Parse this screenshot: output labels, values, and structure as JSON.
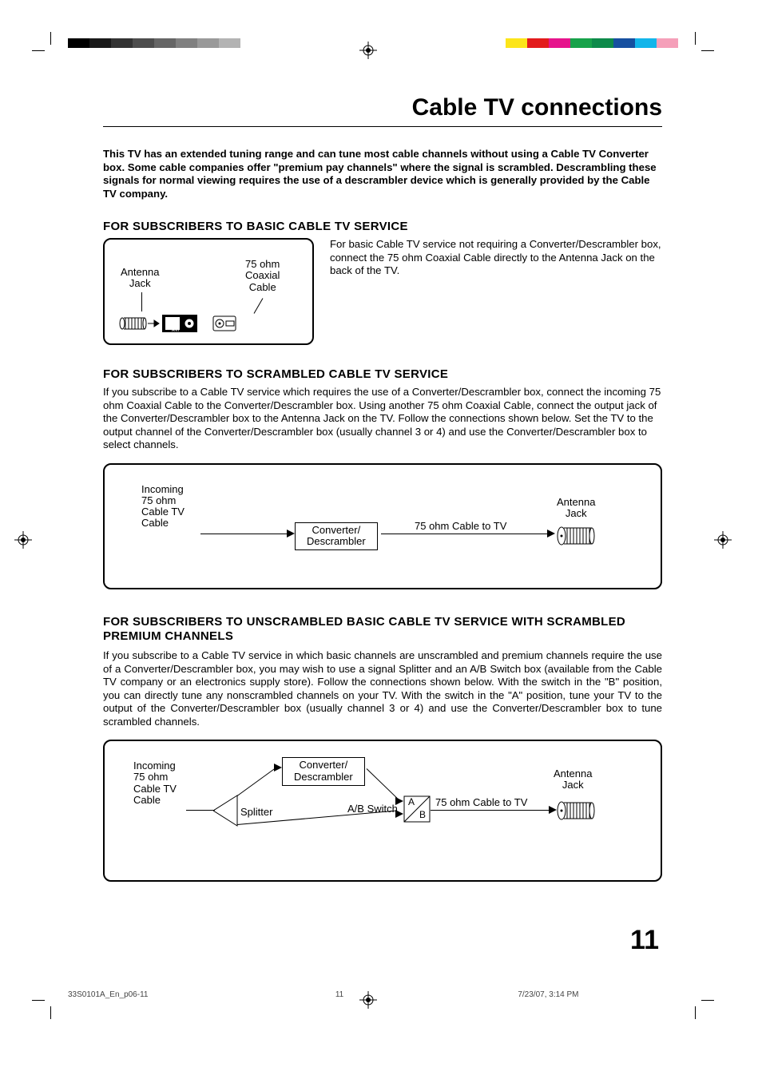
{
  "title": "Cable TV connections",
  "intro": "This TV has an extended tuning range and can tune most cable channels without using a Cable TV Converter box. Some cable companies offer \"premium pay channels\" where the signal is scrambled. Descrambling these signals for normal viewing requires the use of a descrambler device which is generally provided by the Cable TV company.",
  "section1": {
    "heading": "FOR SUBSCRIBERS TO BASIC CABLE TV SERVICE",
    "text": "For basic Cable TV service not requiring a Converter/Descrambler box, connect the 75 ohm Coaxial Cable directly to the Antenna Jack on the back of the TV.",
    "label_antenna": "Antenna\nJack",
    "label_cable": "75 ohm\nCoaxial\nCable",
    "ant_port": "ANT"
  },
  "section2": {
    "heading": "FOR SUBSCRIBERS TO SCRAMBLED CABLE TV SERVICE",
    "text": "If you subscribe to a Cable TV service which requires the use of a Converter/Descrambler box, connect the incoming 75 ohm Coaxial Cable to the Converter/Descrambler box. Using another 75 ohm Coaxial Cable, connect the output jack of the Converter/Descrambler box to the Antenna Jack on the TV. Follow the connections shown below. Set the TV to the output channel of the Converter/Descrambler box (usually channel 3 or 4) and use the Converter/Descrambler box to select channels.",
    "label_incoming": "Incoming\n75 ohm\nCable TV\nCable",
    "label_conv": "Converter/\nDescrambler",
    "label_cable_tv": "75 ohm Cable to TV",
    "label_antenna": "Antenna\nJack"
  },
  "section3": {
    "heading": "FOR SUBSCRIBERS TO UNSCRAMBLED BASIC CABLE TV SERVICE WITH SCRAMBLED PREMIUM CHANNELS",
    "text": "If you subscribe to a Cable TV service in which basic channels are unscrambled and premium channels require the use of a Converter/Descrambler box, you may wish to use a signal Splitter and an A/B Switch box (available from the Cable TV company or an electronics supply store). Follow the connections shown below. With the switch in the \"B\" position, you can directly tune any nonscrambled channels on your TV. With the switch in the \"A\" position, tune your TV to the output of the Converter/Descrambler box (usually channel 3 or 4) and use the Converter/Descrambler box to tune scrambled channels.",
    "label_incoming": "Incoming\n75 ohm\nCable TV\nCable",
    "label_splitter": "Splitter",
    "label_conv": "Converter/\nDescrambler",
    "label_ab": "A/B Switch",
    "label_a": "A",
    "label_b": "B",
    "label_cable_tv": "75 ohm Cable to TV",
    "label_antenna": "Antenna\nJack"
  },
  "page_number": "11",
  "footer": {
    "left": "33S0101A_En_p06-11",
    "center": "11",
    "right": "7/23/07, 3:14 PM"
  },
  "colors_left": [
    "#000",
    "#1a1a1a",
    "#333",
    "#4d4d4d",
    "#666",
    "#808080",
    "#999",
    "#b3b3b3"
  ],
  "colors_right": [
    "#fce51a",
    "#e31b1c",
    "#e6148c",
    "#17a24a",
    "#0d8a4a",
    "#1650a0",
    "#13b5ea",
    "#f59fb9"
  ]
}
